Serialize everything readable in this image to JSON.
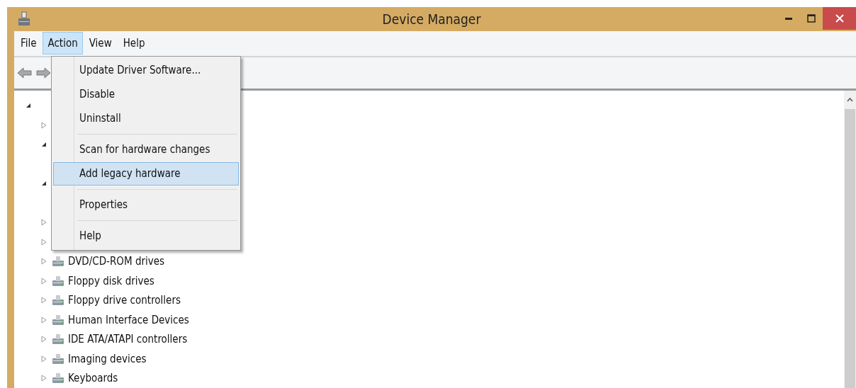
{
  "window": {
    "title": "Device Manager"
  },
  "menu_bar": [
    {
      "label": "File",
      "selected": false
    },
    {
      "label": "Action",
      "selected": true
    },
    {
      "label": "View",
      "selected": false
    },
    {
      "label": "Help",
      "selected": false
    }
  ],
  "dropdown": [
    {
      "kind": "item",
      "label": "Update Driver Software...",
      "selected": false
    },
    {
      "kind": "item",
      "label": "Disable",
      "selected": false
    },
    {
      "kind": "item",
      "label": "Uninstall",
      "selected": false
    },
    {
      "kind": "separator"
    },
    {
      "kind": "item",
      "label": "Scan for hardware changes",
      "selected": false
    },
    {
      "kind": "item",
      "label": "Add legacy hardware",
      "selected": true
    },
    {
      "kind": "separator"
    },
    {
      "kind": "item",
      "label": "Properties",
      "selected": false
    },
    {
      "kind": "separator"
    },
    {
      "kind": "item",
      "label": "Help",
      "selected": false
    }
  ],
  "tree": [
    {
      "expanded": true,
      "children": [
        {
          "expanded": false
        },
        {
          "expanded": true
        },
        {
          "expanded": true
        },
        {
          "expanded": false
        },
        {
          "expanded": false
        },
        {
          "label": "DVD/CD-ROM drives",
          "expanded": false
        },
        {
          "label": "Floppy disk drives",
          "expanded": false
        },
        {
          "label": "Floppy drive controllers",
          "expanded": false
        },
        {
          "label": "Human Interface Devices",
          "expanded": false
        },
        {
          "label": "IDE ATA/ATAPI controllers",
          "expanded": false
        },
        {
          "label": "Imaging devices",
          "expanded": false
        },
        {
          "label": "Keyboards",
          "expanded": false
        }
      ]
    }
  ]
}
